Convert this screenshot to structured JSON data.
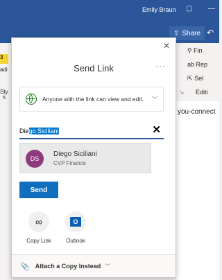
{
  "titlebar": {
    "user_name": "Emily Braun",
    "minimize": "—"
  },
  "ribbon": {
    "share_label": "Share",
    "right_items": [
      "Fin",
      "Rep",
      "Sel",
      "Editi"
    ],
    "left_items": [
      "3",
      "adi",
      "Sty",
      "5"
    ]
  },
  "document": {
    "visible_text": "you-connect"
  },
  "dialog": {
    "title": "Send Link",
    "more": "···",
    "close": "✕",
    "permission_text": "Anyone with the link can view and edit.",
    "to_typed": "Die",
    "to_selected": "go Siciliani",
    "clear": "✕",
    "suggestion": {
      "initials": "DS",
      "name": "Diego Siciliani",
      "title": "CVP Finance",
      "avatar_color": "#8e3a7d"
    },
    "send_label": "Send",
    "copy_link_label": "Copy Link",
    "outlook_label": "Outlook",
    "outlook_glyph": "O",
    "attach_label": "Attach a Copy Instead"
  },
  "colors": {
    "accent": "#2b579a",
    "send_button": "#106ebe",
    "globe": "#107c10"
  }
}
